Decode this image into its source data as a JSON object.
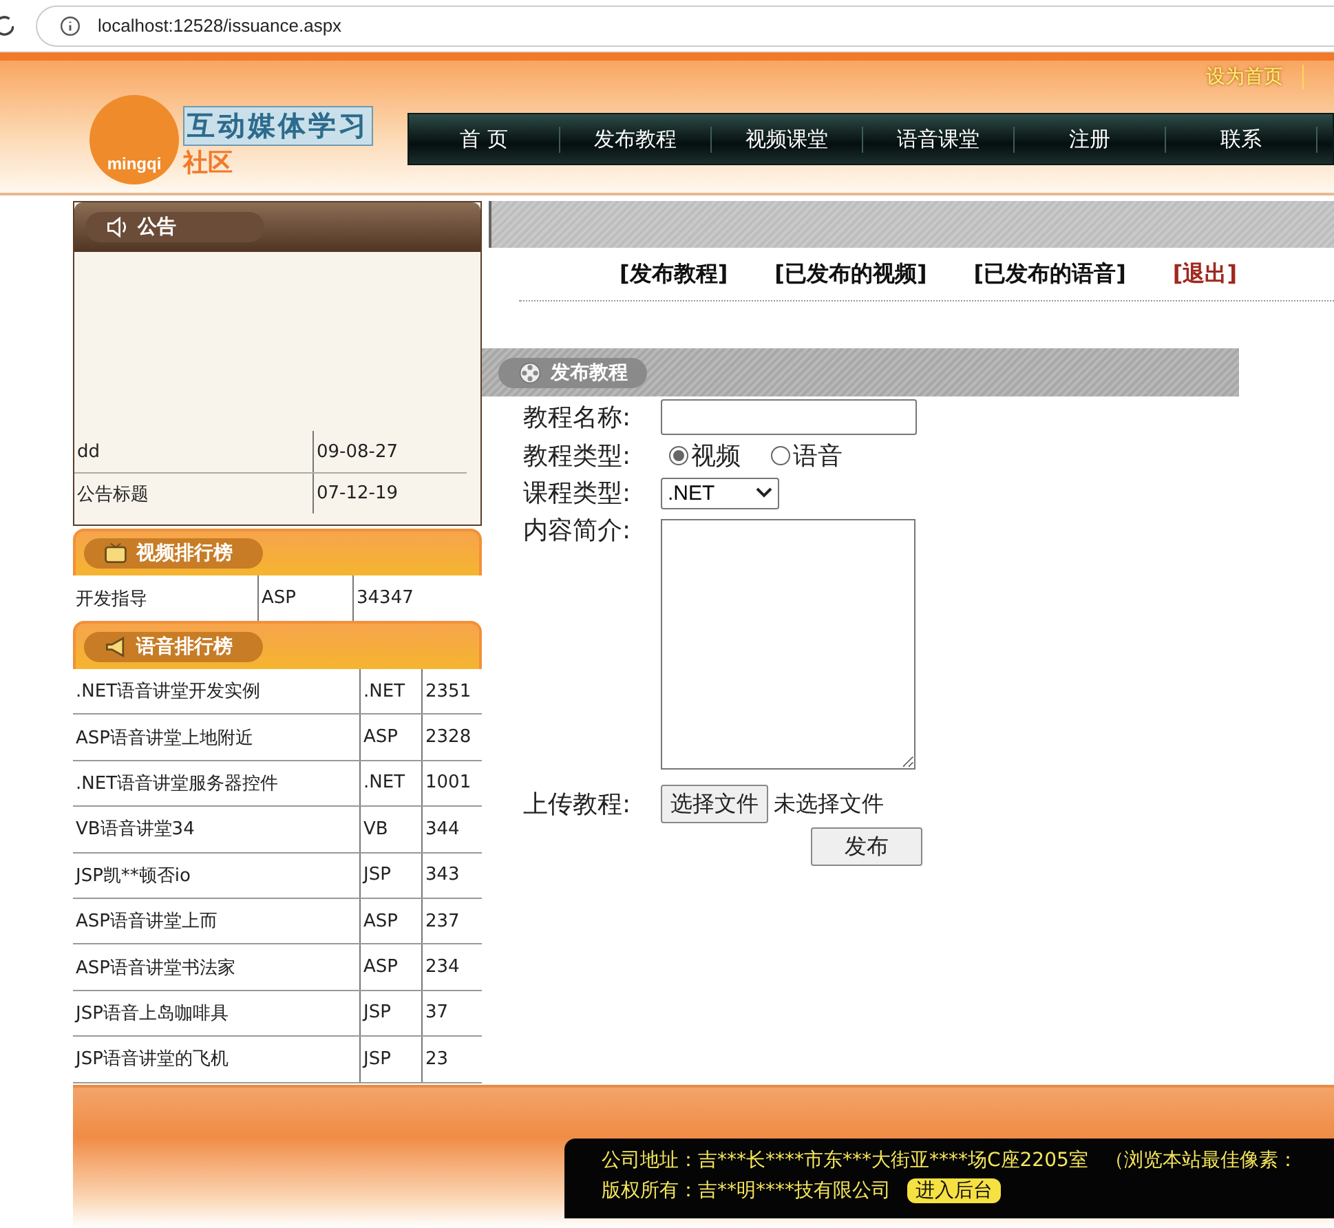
{
  "browser": {
    "url": "localhost:12528/issuance.aspx"
  },
  "header": {
    "logo_title": "互动媒体学习",
    "logo_subtitle": "社区",
    "logo_badge": "mingqi",
    "top_link": "设为首页",
    "nav": [
      "首 页",
      "发布教程",
      "视频课堂",
      "语音课堂",
      "注册",
      "联系"
    ]
  },
  "notice": {
    "title": "公告",
    "rows": [
      {
        "title": "dd",
        "date": "09-08-27"
      },
      {
        "title": "公告标题",
        "date": "07-12-19"
      }
    ]
  },
  "video_ranking": {
    "title": "视频排行榜",
    "rows": [
      {
        "name": "开发指导",
        "category": "ASP",
        "count": "34347"
      }
    ]
  },
  "audio_ranking": {
    "title": "语音排行榜",
    "rows": [
      {
        "name": ".NET语音讲堂开发实例",
        "category": ".NET",
        "count": "2351"
      },
      {
        "name": "ASP语音讲堂上地附近",
        "category": "ASP",
        "count": "2328"
      },
      {
        "name": ".NET语音讲堂服务器控件",
        "category": ".NET",
        "count": "1001"
      },
      {
        "name": "VB语音讲堂34",
        "category": "VB",
        "count": "344"
      },
      {
        "name": "JSP凯**顿否io",
        "category": "JSP",
        "count": "343"
      },
      {
        "name": "ASP语音讲堂上而",
        "category": "ASP",
        "count": "237"
      },
      {
        "name": "ASP语音讲堂书法家",
        "category": "ASP",
        "count": "234"
      },
      {
        "name": "JSP语音上岛咖啡具",
        "category": "JSP",
        "count": "37"
      },
      {
        "name": "JSP语音讲堂的飞机",
        "category": "JSP",
        "count": "23"
      }
    ]
  },
  "user_links": [
    {
      "label": "[发布教程]",
      "kind": "normal"
    },
    {
      "label": "[已发布的视频]",
      "kind": "normal"
    },
    {
      "label": "[已发布的语音]",
      "kind": "normal"
    },
    {
      "label": "[退出]",
      "kind": "exit"
    }
  ],
  "publish_form": {
    "title": "发布教程",
    "name_label": "教程名称:",
    "type_label": "教程类型:",
    "type_options": [
      {
        "label": "视频",
        "selected": true
      },
      {
        "label": "语音",
        "selected": false
      }
    ],
    "course_label": "课程类型:",
    "course_value": ".NET",
    "intro_label": "内容简介:",
    "upload_label": "上传教程:",
    "file_button": "选择文件",
    "file_status": "未选择文件",
    "submit": "发布"
  },
  "footer": {
    "address": "公司地址：吉***长****市东***大街亚****场C座2205室",
    "note": "（浏览本站最佳像素：",
    "copyright": "版权所有：吉**明****技有限公司",
    "admin_button": "进入后台"
  }
}
